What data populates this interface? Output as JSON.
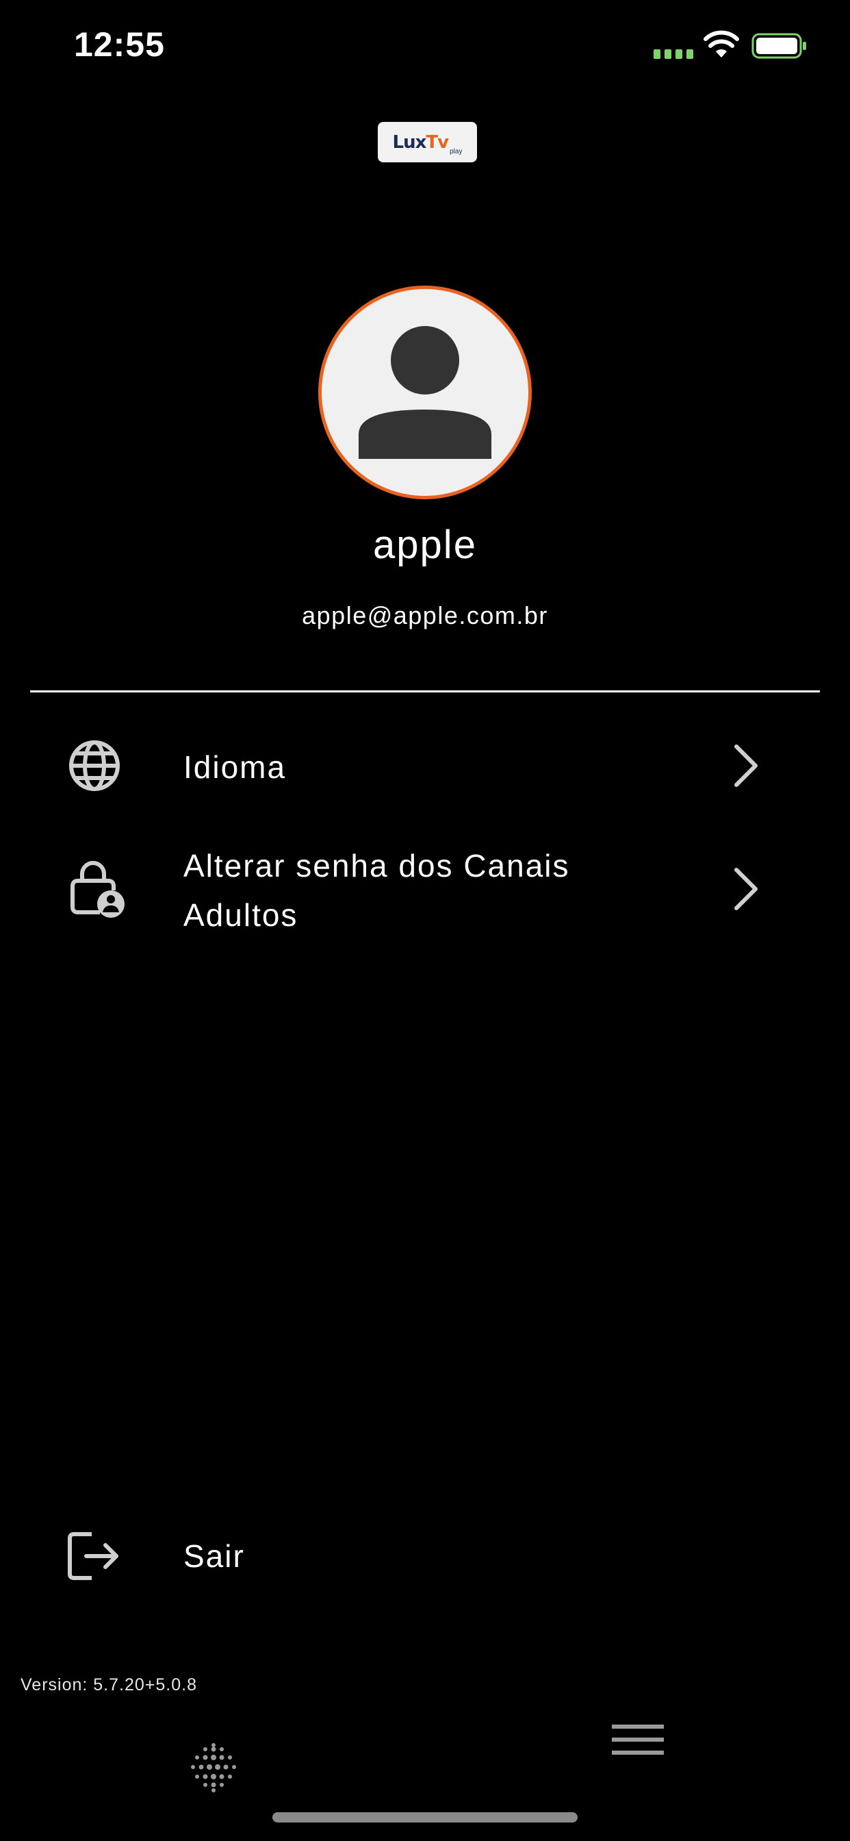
{
  "status_bar": {
    "time": "12:55",
    "signal_icon": "cellular-signal-icon",
    "wifi_icon": "wifi-icon",
    "battery_icon": "battery-icon",
    "battery_color": "#7ed36b"
  },
  "logo": {
    "text_main": "Lux",
    "text_accent": "Tv",
    "text_sub": "play",
    "accent_color": "#e8631f"
  },
  "profile": {
    "name": "apple",
    "email": "apple@apple.com.br",
    "avatar_icon": "person-icon",
    "avatar_border_color": "#e8631f"
  },
  "menu": {
    "items": [
      {
        "label": "Idioma",
        "icon": "globe-icon"
      },
      {
        "label": "Alterar senha dos Canais Adultos",
        "icon": "lock-person-icon"
      }
    ]
  },
  "logout": {
    "label": "Sair",
    "icon": "logout-icon"
  },
  "footer": {
    "version": "Version: 5.7.20+5.0.8"
  },
  "bottom_nav": {
    "items": [
      {
        "icon": "dots-grid-icon"
      },
      {
        "icon": "hamburger-menu-icon"
      }
    ]
  }
}
